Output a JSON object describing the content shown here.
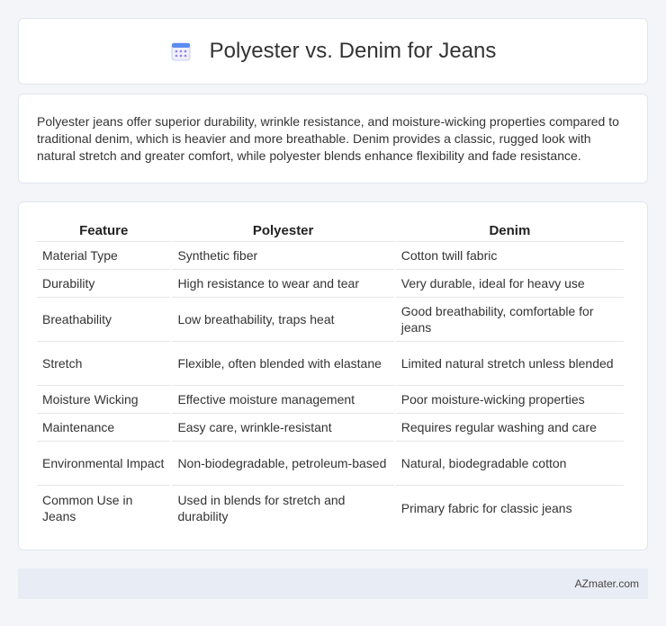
{
  "header": {
    "title": "Polyester vs. Denim for Jeans",
    "icon": "calendar-icon"
  },
  "summary": {
    "text": "Polyester jeans offer superior durability, wrinkle resistance, and moisture-wicking properties compared to traditional denim, which is heavier and more breathable. Denim provides a classic, rugged look with natural stretch and greater comfort, while polyester blends enhance flexibility and fade resistance."
  },
  "table": {
    "headers": [
      "Feature",
      "Polyester",
      "Denim"
    ],
    "rows": [
      [
        "Material Type",
        "Synthetic fiber",
        "Cotton twill fabric"
      ],
      [
        "Durability",
        "High resistance to wear and tear",
        "Very durable, ideal for heavy use"
      ],
      [
        "Breathability",
        "Low breathability, traps heat",
        "Good breathability, comfortable for jeans"
      ],
      [
        "Stretch",
        "Flexible, often blended with elastane",
        "Limited natural stretch unless blended"
      ],
      [
        "Moisture Wicking",
        "Effective moisture management",
        "Poor moisture-wicking properties"
      ],
      [
        "Maintenance",
        "Easy care, wrinkle-resistant",
        "Requires regular washing and care"
      ],
      [
        "Environmental Impact",
        "Non-biodegradable, petroleum-based",
        "Natural, biodegradable cotton"
      ],
      [
        "Common Use in Jeans",
        "Used in blends for stretch and durability",
        "Primary fabric for classic jeans"
      ]
    ]
  },
  "footer": {
    "text": "AZmater.com"
  }
}
